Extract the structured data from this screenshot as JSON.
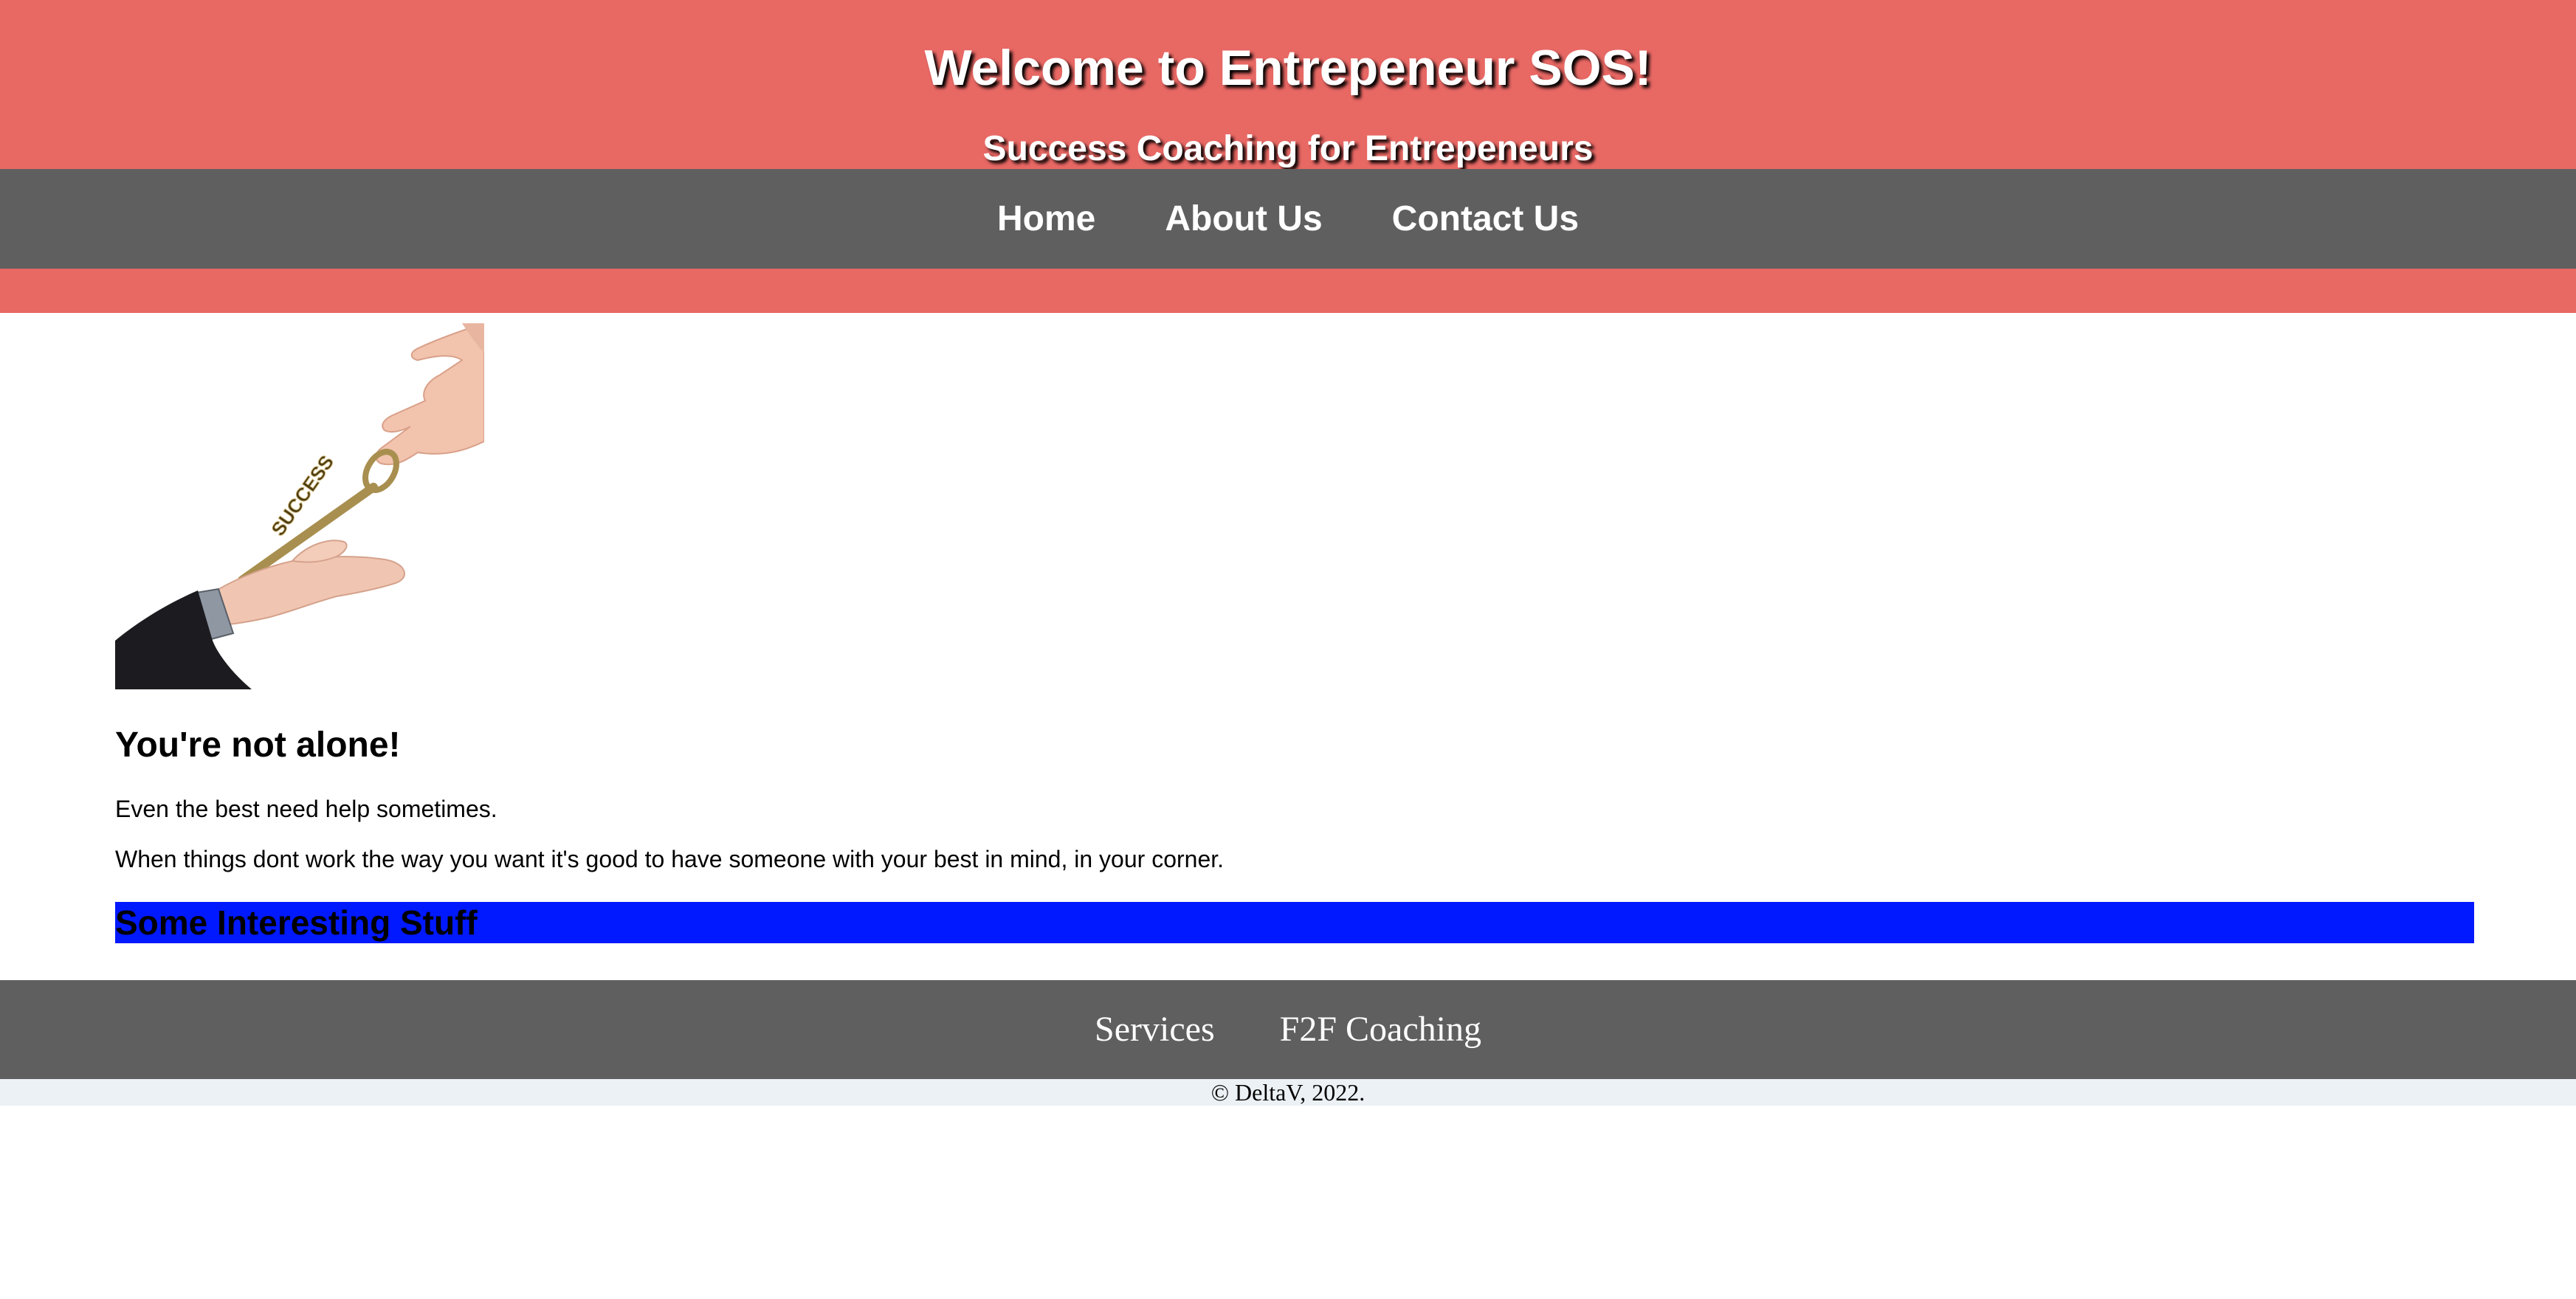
{
  "header": {
    "title": "Welcome to Entrepeneur SOS!",
    "subtitle": "Success Coaching for Entrepeneurs",
    "background_color": "#e86864"
  },
  "nav": {
    "items": [
      {
        "label": "Home"
      },
      {
        "label": "About Us"
      },
      {
        "label": "Contact Us"
      }
    ],
    "background_color": "#5f5f5f"
  },
  "hero": {
    "image": "hand-passing-success-key-image",
    "key_text": "SUCCESS"
  },
  "content": {
    "heading": "You're not alone!",
    "paragraphs": [
      "Even the best need help sometimes.",
      "When things dont work the way you want it's good to have someone with your best in mind, in your corner."
    ],
    "interesting_heading": "Some Interesting Stuff",
    "interesting_bg_color": "#0019ff"
  },
  "footer": {
    "links": [
      {
        "label": "Services"
      },
      {
        "label": "F2F Coaching"
      }
    ],
    "copyright": "© DeltaV, 2022.",
    "copyright_bg_color": "#ecf1f5"
  }
}
